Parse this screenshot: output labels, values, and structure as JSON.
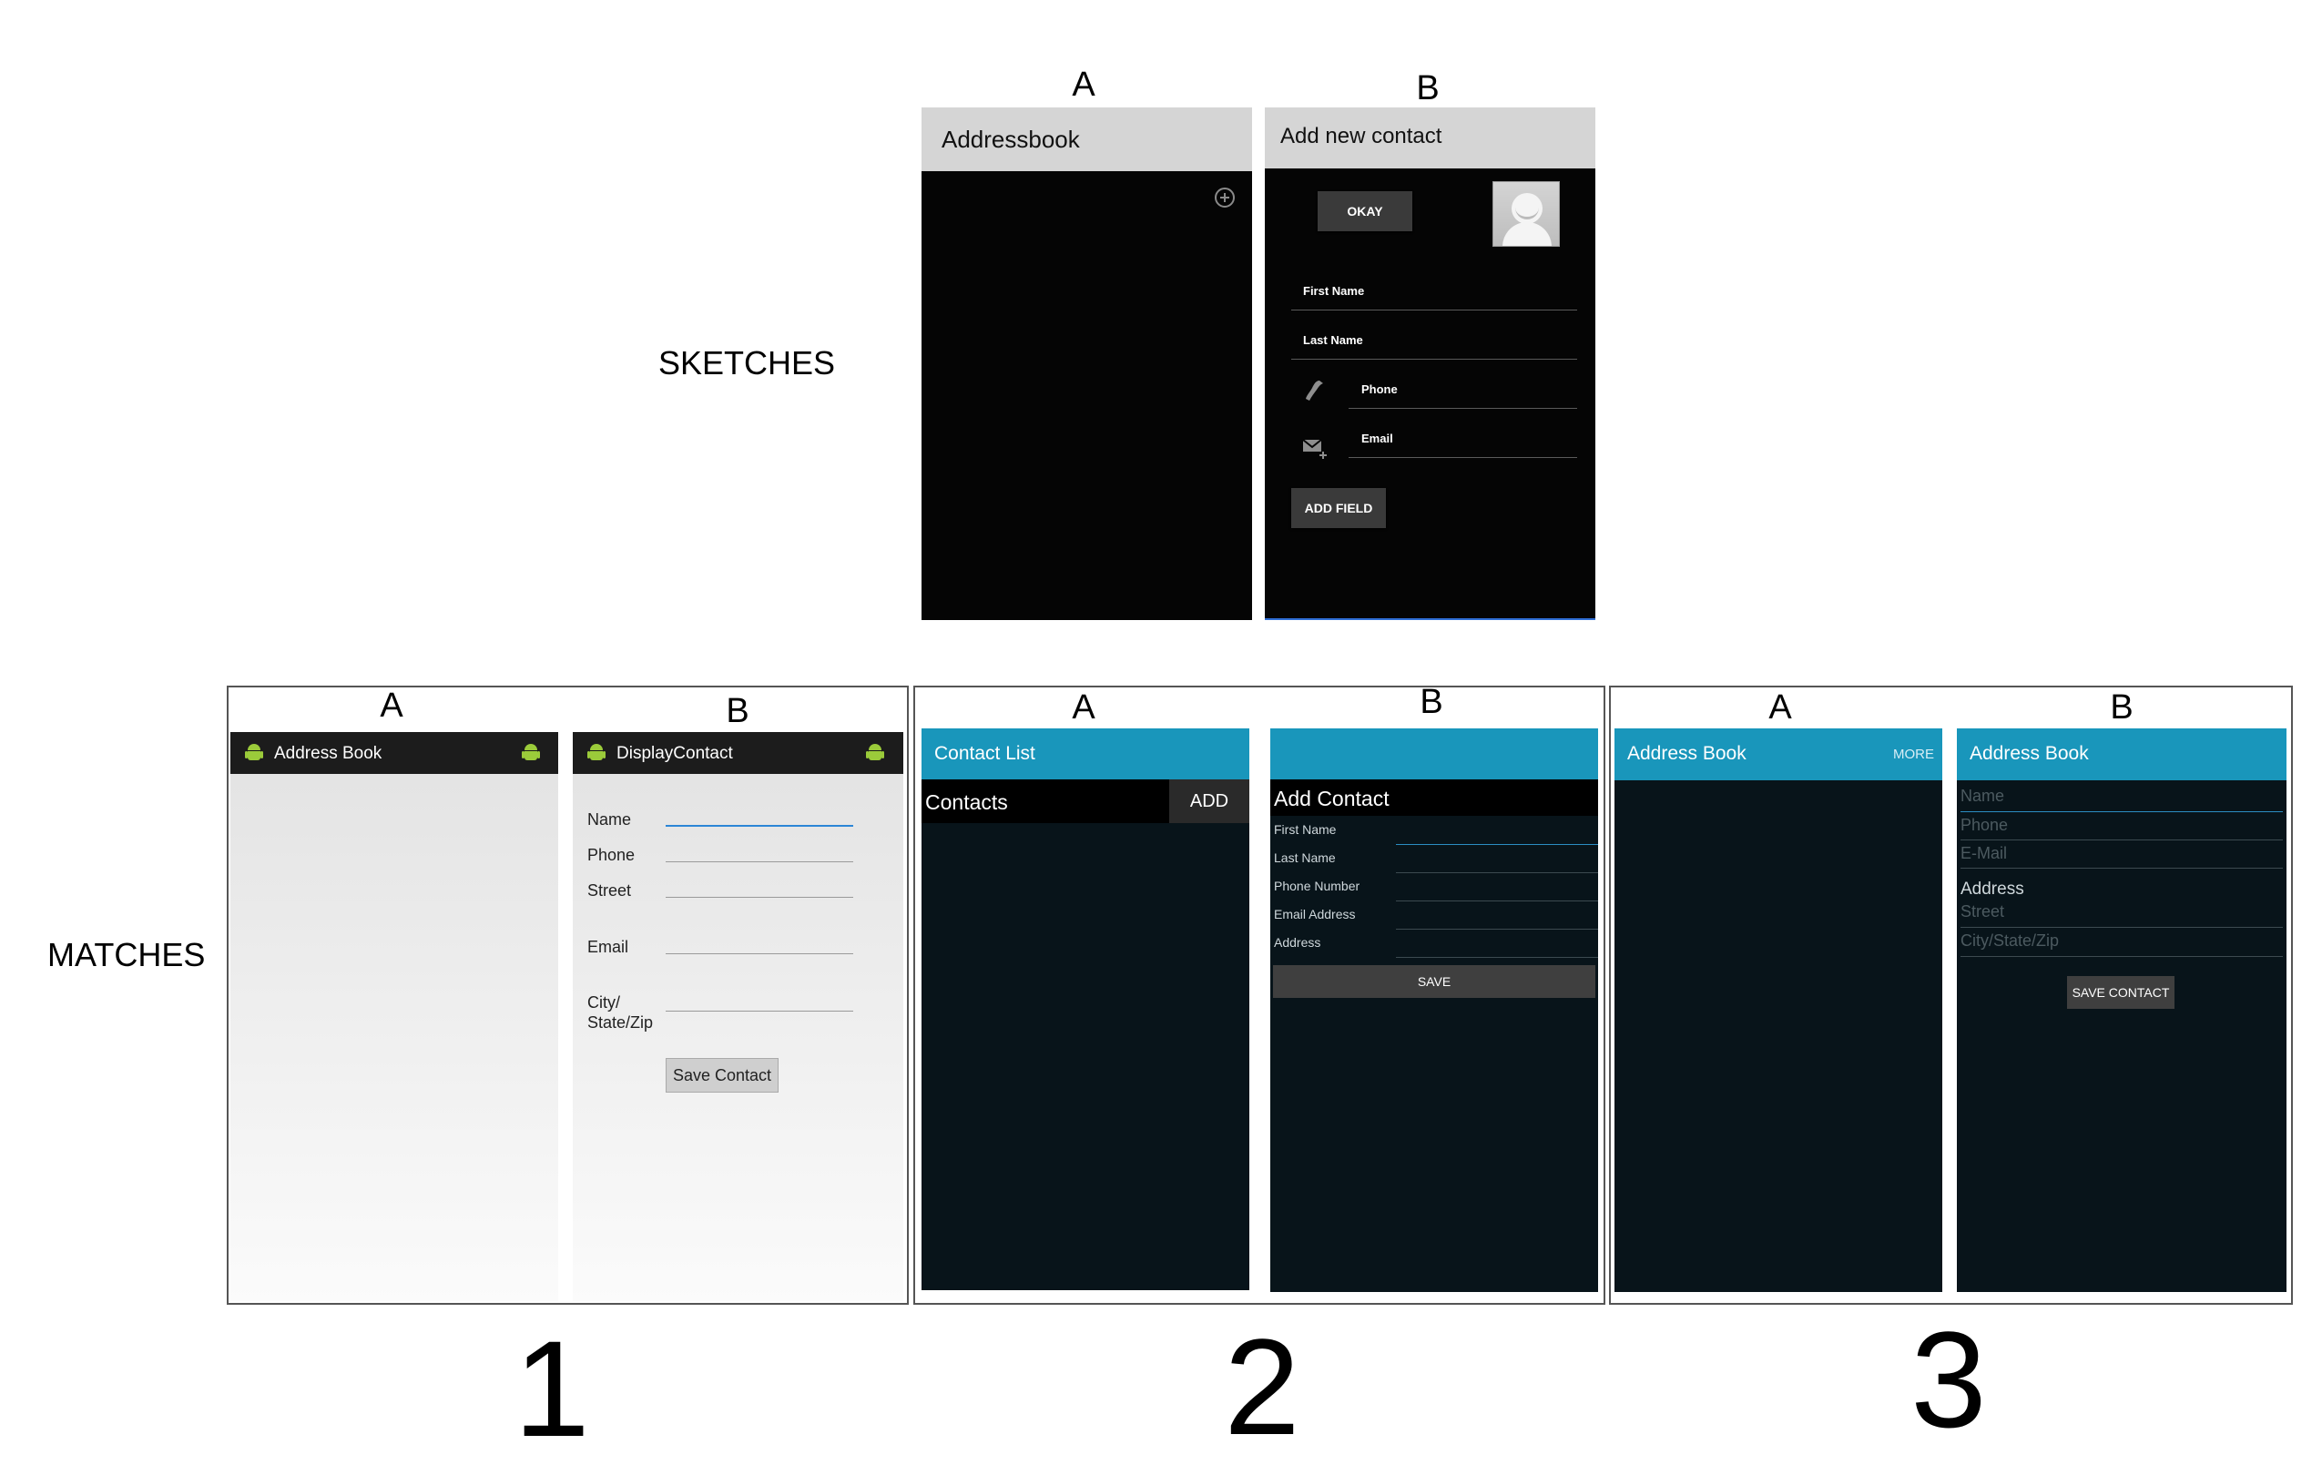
{
  "labels": {
    "sketches": "SKETCHES",
    "matches": "MATCHES",
    "screen_a": "A",
    "screen_b": "B",
    "match_1": "1",
    "match_2": "2",
    "match_3": "3"
  },
  "sketch": {
    "a": {
      "title": "Addressbook",
      "add_icon": "plus-circle-icon"
    },
    "b": {
      "title": "Add new contact",
      "okay_button": "OKAY",
      "avatar_icon": "person-avatar-icon",
      "fields": [
        "First Name",
        "Last Name",
        "Phone",
        "Email"
      ],
      "phone_icon": "phone-icon",
      "email_icon": "mail-add-icon",
      "add_field_button": "ADD FIELD"
    }
  },
  "match1": {
    "a": {
      "title": "Address Book"
    },
    "b": {
      "title": "DisplayContact",
      "fields": [
        "Name",
        "Phone",
        "Street",
        "Email",
        "City/",
        "State/Zip"
      ],
      "save_button": "Save Contact"
    }
  },
  "match2": {
    "a": {
      "title": "Contact List",
      "section": "Contacts",
      "add_button": "ADD"
    },
    "b": {
      "section": "Add Contact",
      "fields": [
        "First Name",
        "Last Name",
        "Phone Number",
        "Email Address",
        "Address"
      ],
      "save_button": "SAVE"
    }
  },
  "match3": {
    "a": {
      "title": "Address Book",
      "more_button": "MORE"
    },
    "b": {
      "title": "Address Book",
      "hints": [
        "Name",
        "Phone",
        "E-Mail"
      ],
      "address_label": "Address",
      "address_hints": [
        "Street",
        "City/State/Zip"
      ],
      "save_button": "SAVE CONTACT"
    }
  },
  "colors": {
    "teal": "#1996bb",
    "dark_bg": "#08141a",
    "android_green": "#9bcb3a"
  }
}
